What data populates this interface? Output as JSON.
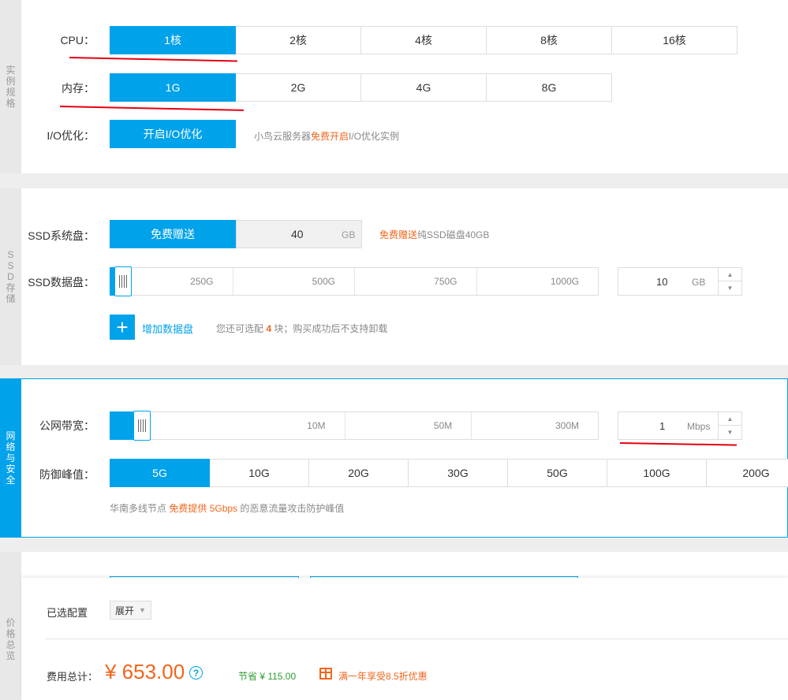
{
  "instance": {
    "side_label": "实例规格",
    "cpu_label": "CPU：",
    "cpu_options": [
      "1核",
      "2核",
      "4核",
      "8核",
      "16核"
    ],
    "memory_label": "内存：",
    "memory_options": [
      "1G",
      "2G",
      "4G",
      "8G"
    ],
    "io_label": "I/O优化：",
    "io_button": "开启I/O优化",
    "io_hint_prefix": "小鸟云服务器",
    "io_hint_highlight": "免费开启",
    "io_hint_suffix": "I/O优化实例"
  },
  "storage": {
    "side_label": "SSD存储",
    "system_disk_label": "SSD系统盘：",
    "system_disk_free": "免费赠送",
    "system_disk_size": "40",
    "system_disk_unit": "GB",
    "system_hint_highlight": "免费赠送",
    "system_hint_suffix": "纯SSD磁盘40GB",
    "data_disk_label": "SSD数据盘：",
    "data_disk_ticks": [
      "250G",
      "500G",
      "750G",
      "1000G"
    ],
    "data_disk_value": "10",
    "data_disk_unit": "GB",
    "data_disk_level_gb": 10,
    "add_disk_label": "增加数据盘",
    "add_hint_prefix": "您还可选配",
    "add_hint_count": "4",
    "add_hint_suffix": "块；购买成功后不支持卸载"
  },
  "network": {
    "side_label": "网络与安全",
    "bandwidth_label": "公网带宽：",
    "bandwidth_ticks": [
      "10M",
      "50M",
      "300M"
    ],
    "bandwidth_value": "1",
    "bandwidth_unit": "Mbps",
    "defense_label": "防御峰值：",
    "defense_options": [
      "5G",
      "10G",
      "20G",
      "30G",
      "50G",
      "100G",
      "200G"
    ],
    "defense_hint_prefix": "华南多线节点",
    "defense_hint_highlight": "免费提供 5Gbps",
    "defense_hint_suffix": "的恶意流量攻击防护峰值"
  },
  "price": {
    "side_label": "价格总览",
    "selected_config_label": "已选配置",
    "expand_label": "展开",
    "total_label": "费用总计：",
    "total_value": "¥ 653.00",
    "help_icon": "?",
    "saving": "节省 ¥ 115.00",
    "promo": "满一年享受8.5折优惠"
  },
  "colors": {
    "accent": "#00a2ea",
    "orange": "#f1651c",
    "green": "#2e9e2e",
    "red_annotation": "#e60012"
  }
}
